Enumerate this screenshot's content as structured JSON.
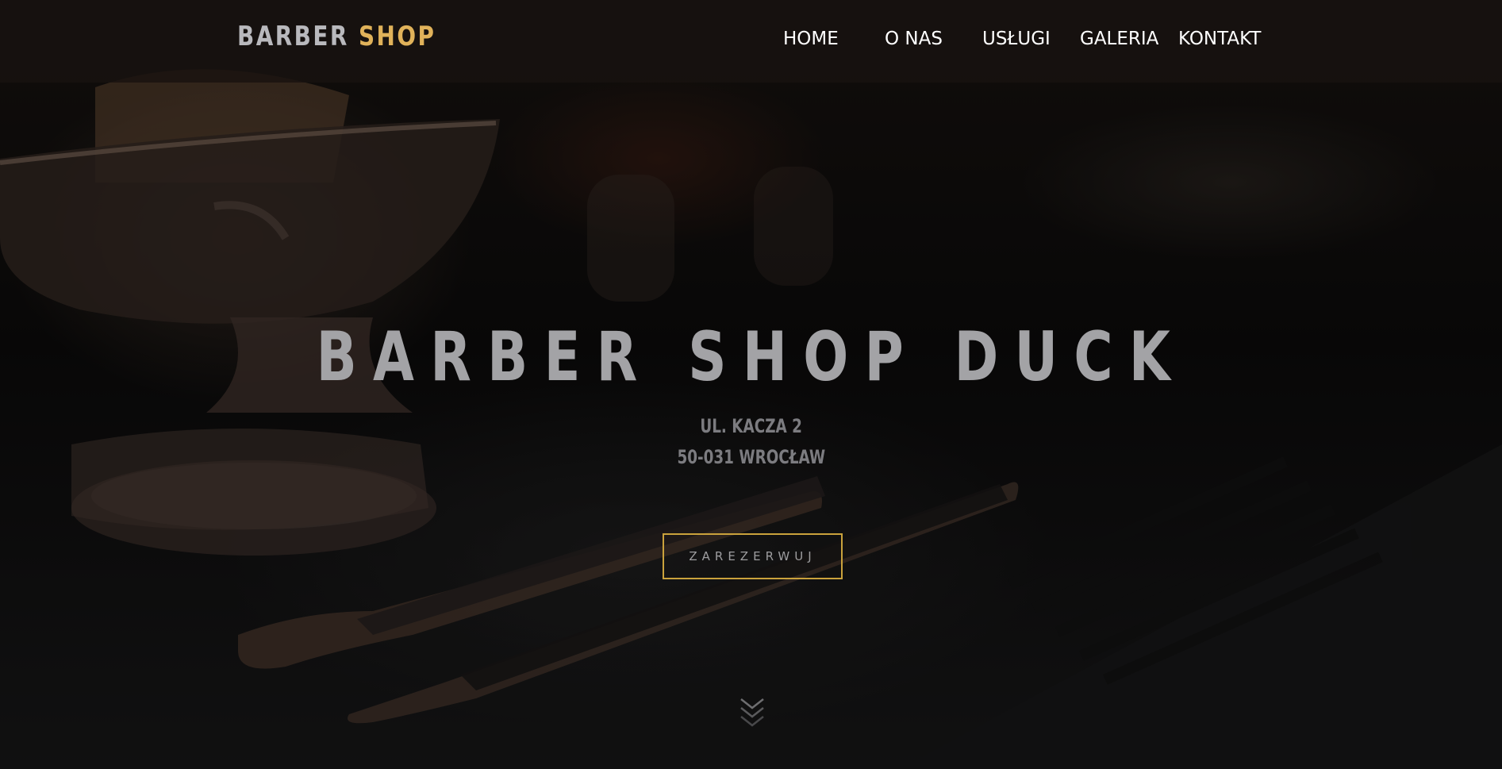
{
  "brand": {
    "word1": "BARBER",
    "word2": "SHOP"
  },
  "nav": {
    "home": "HOME",
    "about": "O NAS",
    "services": "USŁUGI",
    "gallery": "GALERIA",
    "contact": "KONTAKT"
  },
  "hero": {
    "title": "BARBER SHOP DUCK",
    "address_line1": "UL. KACZA 2",
    "address_line2": "50-031 WROCŁAW",
    "button_label": "ZAREZERWUJ"
  },
  "icons": {
    "scroll": "chevrons-down-icon"
  },
  "colors": {
    "accent": "#e0b25a",
    "button_border": "#caa23c",
    "nav_bg": "#191210",
    "title": "#a3a3a6"
  }
}
